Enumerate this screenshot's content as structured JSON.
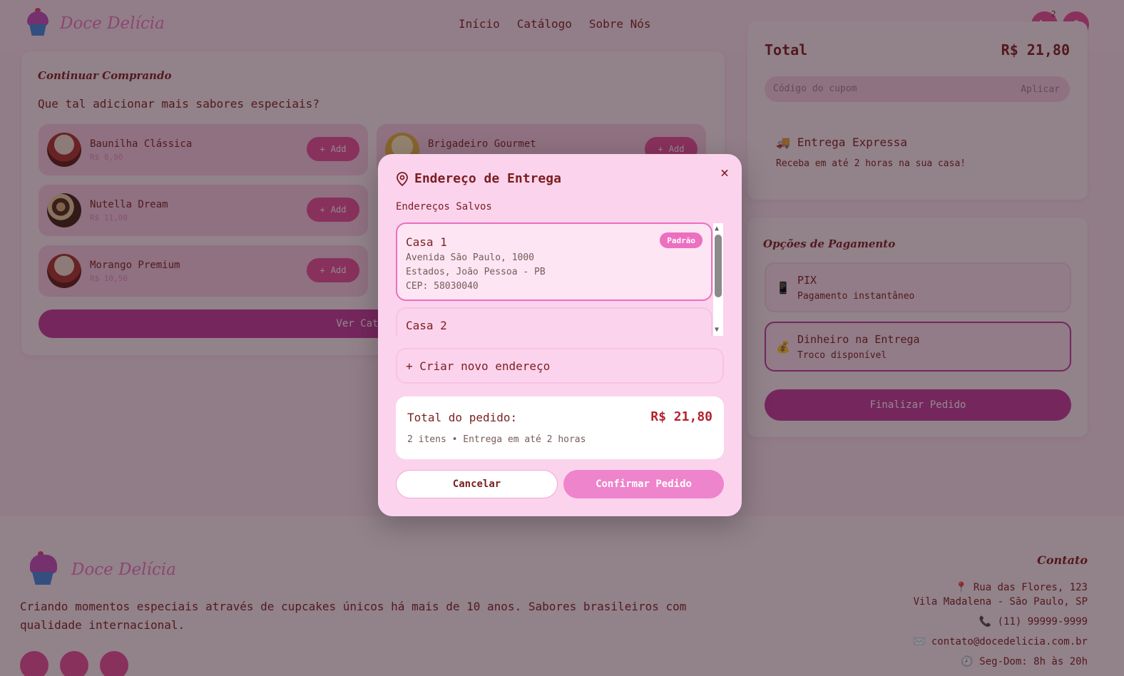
{
  "header": {
    "brand": "Doce Delícia",
    "nav": [
      "Início",
      "Catálogo",
      "Sobre Nós"
    ],
    "cart_count": "2"
  },
  "continue": {
    "title": "Continuar Comprando",
    "subtitle": "Que tal adicionar mais sabores especiais?",
    "add_label": "Add",
    "products": [
      {
        "name": "Baunilha Clássica",
        "price": "R$ 8,90"
      },
      {
        "name": "Brigadeiro Gourmet",
        "price": ""
      },
      {
        "name": "Nutella Dream",
        "price": "R$ 11,00"
      },
      {
        "name": "Morango Premium",
        "price": "R$ 10,50"
      }
    ],
    "catalog_button": "Ver Catálogo"
  },
  "summary": {
    "total_label": "Total",
    "total_value": "R$ 21,80",
    "coupon_placeholder": "Código do cupom",
    "coupon_apply": "Aplicar",
    "express_title": "Entrega Expressa",
    "express_sub": "Receba em até 2 horas na sua casa!"
  },
  "payment": {
    "title": "Opções de Pagamento",
    "options": [
      {
        "name": "PIX",
        "desc": "Pagamento instantâneo",
        "icon": "phone-icon"
      },
      {
        "name": "Dinheiro na Entrega",
        "desc": "Troco disponível",
        "icon": "money-bag-icon"
      }
    ],
    "finalize": "Finalizar Pedido"
  },
  "footer": {
    "brand": "Doce Delícia",
    "description": "Criando momentos especiais através de cupcakes únicos há mais de 10 anos. Sabores brasileiros com qualidade internacional.",
    "contact_title": "Contato",
    "address1": "Rua das Flores, 123",
    "address2": "Vila Madalena - São Paulo, SP",
    "phone": "(11) 99999-9999",
    "email": "contato@docedelicia.com.br",
    "hours": "Seg-Dom: 8h às 20h"
  },
  "modal": {
    "title": "Endereço de Entrega",
    "saved_label": "Endereços Salvos",
    "addresses": [
      {
        "name": "Casa 1",
        "street": "Avenida São Paulo, 1000",
        "city": "Estados, João Pessoa - PB",
        "cep": "CEP: 58030040",
        "badge": "Padrão"
      },
      {
        "name": "Casa 2"
      }
    ],
    "new_address": "+ Criar novo endereço",
    "total_label": "Total do pedido:",
    "total_value": "R$ 21,80",
    "total_sub": "2 itens • Entrega em até 2 horas",
    "cancel": "Cancelar",
    "confirm": "Confirmar Pedido"
  },
  "colors": {
    "accent": "#e94f9b",
    "brand_pink": "#ee78c4",
    "dark_text": "#7a1f1f",
    "price_red": "#b3232e"
  }
}
